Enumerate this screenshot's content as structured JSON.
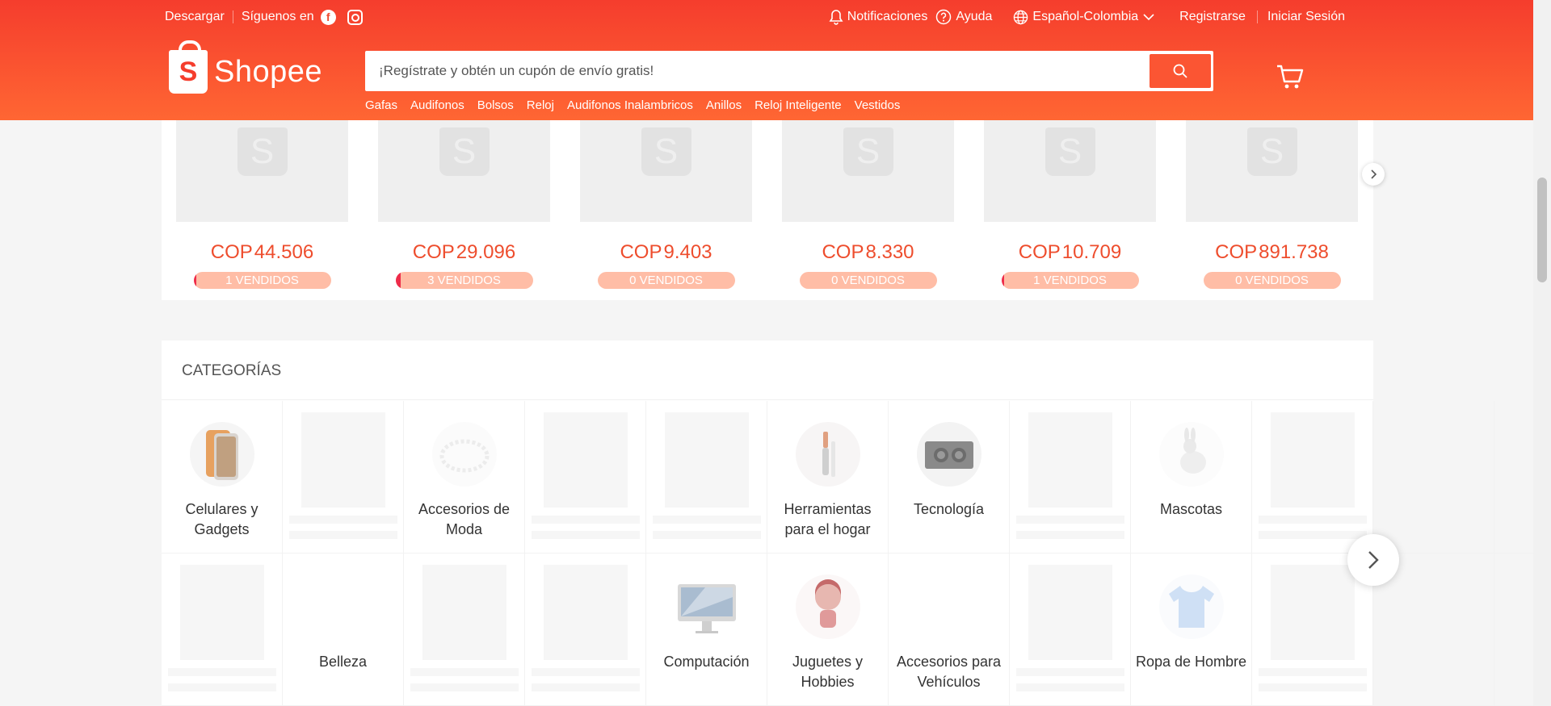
{
  "header": {
    "download": "Descargar",
    "follow_us": "Síguenos en",
    "facebook_icon": "f",
    "notifications": "Notificaciones",
    "help": "Ayuda",
    "language": "Español-Colombia",
    "register": "Registrarse",
    "login": "Iniciar Sesión",
    "logo_text": "Shopee",
    "logo_letter": "S",
    "search_placeholder": "¡Regístrate y obtén un cupón de envío gratis!",
    "keywords": [
      "Gafas",
      "Audifonos",
      "Bolsos",
      "Reloj",
      "Audifonos Inalambricos",
      "Anillos",
      "Reloj Inteligente",
      "Vestidos"
    ],
    "colors": {
      "brand": "#f53d2d",
      "brand_light": "#ff6633"
    }
  },
  "products": [
    {
      "currency": "COP",
      "price": "44.506",
      "sold": "1 VENDIDOS",
      "sold_fraction": 0.02
    },
    {
      "currency": "COP",
      "price": "29.096",
      "sold": "3 VENDIDOS",
      "sold_fraction": 0.04
    },
    {
      "currency": "COP",
      "price": "9.403",
      "sold": "0 VENDIDOS",
      "sold_fraction": 0
    },
    {
      "currency": "COP",
      "price": "8.330",
      "sold": "0 VENDIDOS",
      "sold_fraction": 0
    },
    {
      "currency": "COP",
      "price": "10.709",
      "sold": "1 VENDIDOS",
      "sold_fraction": 0.02
    },
    {
      "currency": "COP",
      "price": "891.738",
      "sold": "0 VENDIDOS",
      "sold_fraction": 0
    }
  ],
  "categories": {
    "title": "CATEGORÍAS",
    "row1": [
      {
        "name": "Celulares y Gadgets",
        "icon": "phone-icon"
      },
      {
        "name": "",
        "icon": "placeholder"
      },
      {
        "name": "Accesorios de Moda",
        "icon": "bracelet-icon"
      },
      {
        "name": "",
        "icon": "placeholder"
      },
      {
        "name": "",
        "icon": "placeholder"
      },
      {
        "name": "Herramientas para el hogar",
        "icon": "tool-icon"
      },
      {
        "name": "Tecnología",
        "icon": "speaker-icon"
      },
      {
        "name": "",
        "icon": "placeholder"
      },
      {
        "name": "Mascotas",
        "icon": "pet-icon"
      },
      {
        "name": "",
        "icon": "placeholder"
      }
    ],
    "row2": [
      {
        "name": "",
        "icon": "placeholder"
      },
      {
        "name": "Belleza",
        "icon": "none"
      },
      {
        "name": "",
        "icon": "placeholder"
      },
      {
        "name": "",
        "icon": "placeholder"
      },
      {
        "name": "Computación",
        "icon": "computer-icon"
      },
      {
        "name": "Juguetes y Hobbies",
        "icon": "doll-icon"
      },
      {
        "name": "Accesorios para Vehículos",
        "icon": "none"
      },
      {
        "name": "",
        "icon": "placeholder"
      },
      {
        "name": "Ropa de Hombre",
        "icon": "shirt-icon"
      },
      {
        "name": "",
        "icon": "placeholder"
      }
    ]
  }
}
